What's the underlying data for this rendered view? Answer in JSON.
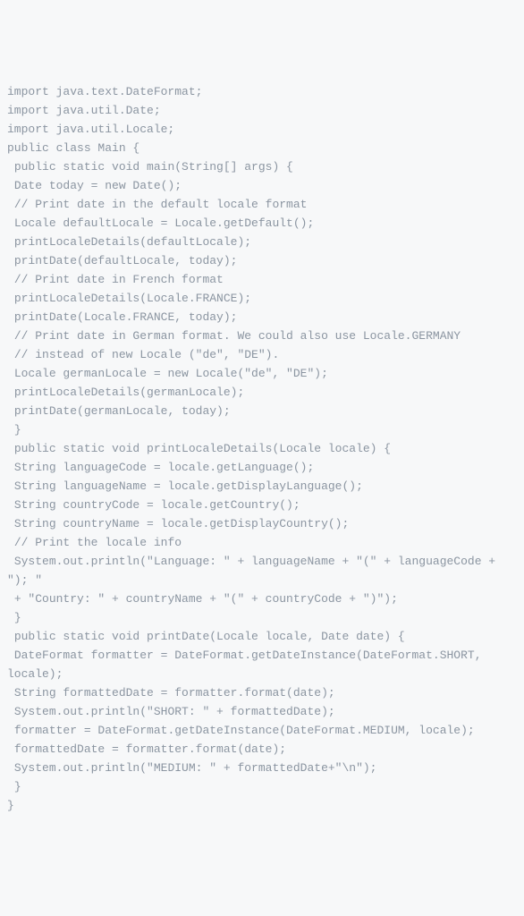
{
  "code_lines": [
    "import java.text.DateFormat;",
    "import java.util.Date;",
    "import java.util.Locale;",
    "public class Main {",
    " public static void main(String[] args) {",
    " Date today = new Date();",
    " // Print date in the default locale format",
    " Locale defaultLocale = Locale.getDefault();",
    " printLocaleDetails(defaultLocale);",
    " printDate(defaultLocale, today);",
    " // Print date in French format",
    " printLocaleDetails(Locale.FRANCE);",
    " printDate(Locale.FRANCE, today);",
    " // Print date in German format. We could also use Locale.GERMANY",
    " // instead of new Locale (\"de\", \"DE\").",
    " Locale germanLocale = new Locale(\"de\", \"DE\");",
    " printLocaleDetails(germanLocale);",
    " printDate(germanLocale, today);",
    " }",
    " public static void printLocaleDetails(Locale locale) {",
    " String languageCode = locale.getLanguage();",
    " String languageName = locale.getDisplayLanguage();",
    " String countryCode = locale.getCountry();",
    " String countryName = locale.getDisplayCountry();",
    " // Print the locale info",
    " System.out.println(\"Language: \" + languageName + \"(\" + languageCode + \"); \"",
    " + \"Country: \" + countryName + \"(\" + countryCode + \")\");",
    " }",
    " public static void printDate(Locale locale, Date date) {",
    " DateFormat formatter = DateFormat.getDateInstance(DateFormat.SHORT, locale);",
    " String formattedDate = formatter.format(date);",
    " System.out.println(\"SHORT: \" + formattedDate);",
    " formatter = DateFormat.getDateInstance(DateFormat.MEDIUM, locale);",
    " formattedDate = formatter.format(date);",
    " System.out.println(\"MEDIUM: \" + formattedDate+\"\\n\");",
    " }",
    "}"
  ]
}
